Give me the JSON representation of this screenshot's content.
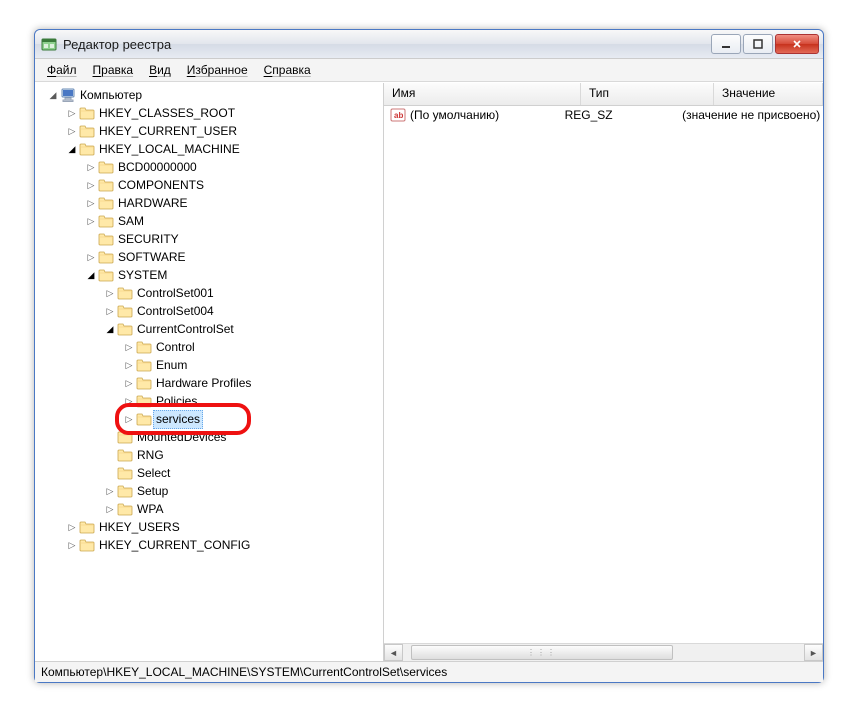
{
  "window": {
    "title": "Редактор реестра"
  },
  "menu": {
    "items": [
      "Файл",
      "Правка",
      "Вид",
      "Избранное",
      "Справка"
    ]
  },
  "tree": {
    "root": "Компьютер",
    "nodes": [
      {
        "label": "HKEY_CLASSES_ROOT",
        "depth": 1,
        "expander": "closed"
      },
      {
        "label": "HKEY_CURRENT_USER",
        "depth": 1,
        "expander": "closed"
      },
      {
        "label": "HKEY_LOCAL_MACHINE",
        "depth": 1,
        "expander": "open"
      },
      {
        "label": "BCD00000000",
        "depth": 2,
        "expander": "closed"
      },
      {
        "label": "COMPONENTS",
        "depth": 2,
        "expander": "closed"
      },
      {
        "label": "HARDWARE",
        "depth": 2,
        "expander": "closed"
      },
      {
        "label": "SAM",
        "depth": 2,
        "expander": "closed"
      },
      {
        "label": "SECURITY",
        "depth": 2,
        "expander": "none"
      },
      {
        "label": "SOFTWARE",
        "depth": 2,
        "expander": "closed"
      },
      {
        "label": "SYSTEM",
        "depth": 2,
        "expander": "open"
      },
      {
        "label": "ControlSet001",
        "depth": 3,
        "expander": "closed"
      },
      {
        "label": "ControlSet004",
        "depth": 3,
        "expander": "closed"
      },
      {
        "label": "CurrentControlSet",
        "depth": 3,
        "expander": "open"
      },
      {
        "label": "Control",
        "depth": 4,
        "expander": "closed"
      },
      {
        "label": "Enum",
        "depth": 4,
        "expander": "closed"
      },
      {
        "label": "Hardware Profiles",
        "depth": 4,
        "expander": "closed"
      },
      {
        "label": "Policies",
        "depth": 4,
        "expander": "closed"
      },
      {
        "label": "services",
        "depth": 4,
        "expander": "closed",
        "selected": true,
        "highlight": true
      },
      {
        "label": "MountedDevices",
        "depth": 3,
        "expander": "none"
      },
      {
        "label": "RNG",
        "depth": 3,
        "expander": "none"
      },
      {
        "label": "Select",
        "depth": 3,
        "expander": "none"
      },
      {
        "label": "Setup",
        "depth": 3,
        "expander": "closed"
      },
      {
        "label": "WPA",
        "depth": 3,
        "expander": "closed"
      },
      {
        "label": "HKEY_USERS",
        "depth": 1,
        "expander": "closed"
      },
      {
        "label": "HKEY_CURRENT_CONFIG",
        "depth": 1,
        "expander": "closed"
      }
    ]
  },
  "list": {
    "columns": {
      "name": "Имя",
      "type": "Тип",
      "value": "Значение"
    },
    "rows": [
      {
        "name": "(По умолчанию)",
        "type": "REG_SZ",
        "value": "(значение не присвоено)"
      }
    ],
    "col_widths": {
      "name": 180,
      "type": 116,
      "value": 140
    }
  },
  "statusbar": {
    "path": "Компьютер\\HKEY_LOCAL_MACHINE\\SYSTEM\\CurrentControlSet\\services"
  },
  "icons": {
    "expander_open": "◢",
    "expander_closed": "▷"
  }
}
